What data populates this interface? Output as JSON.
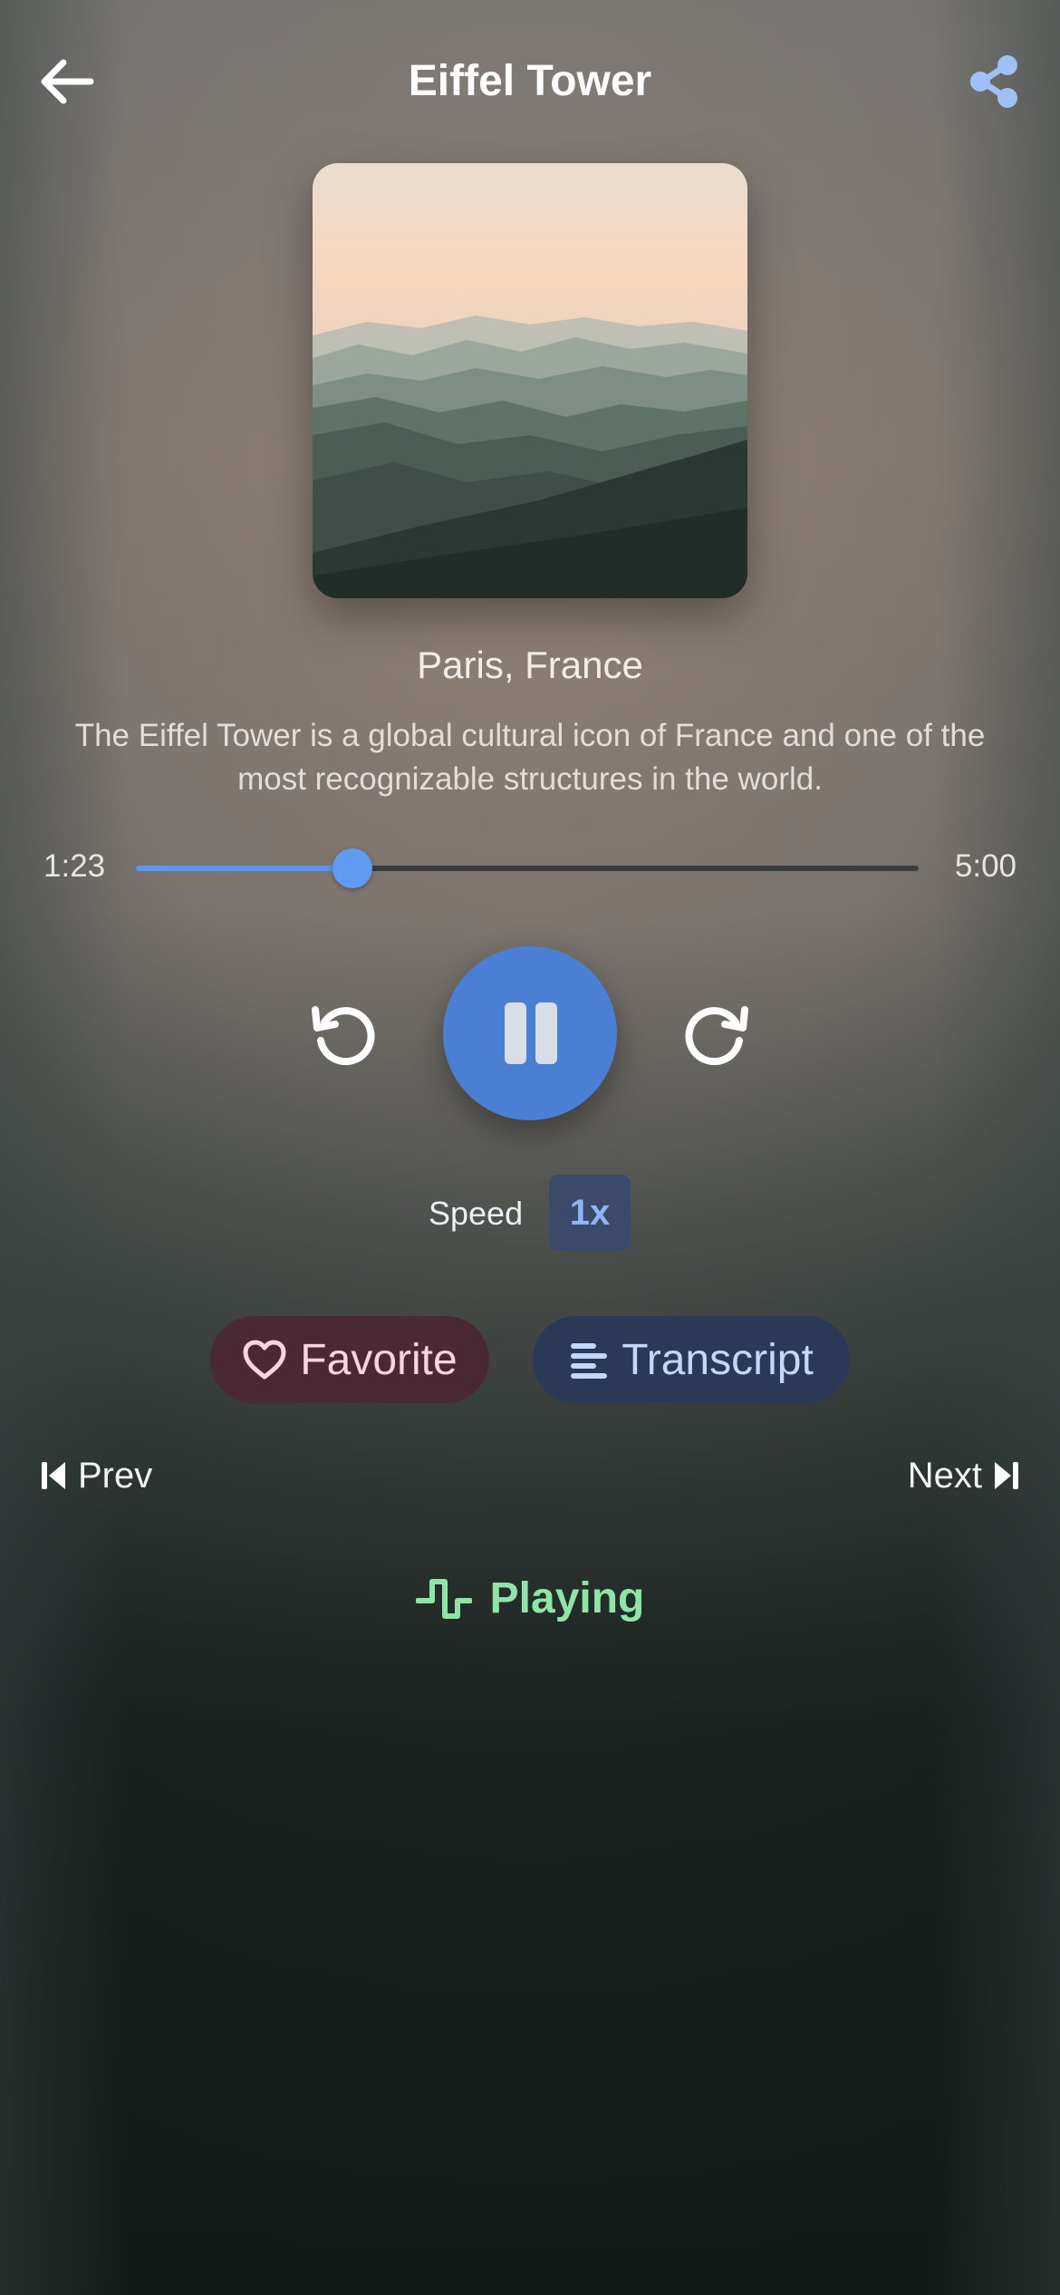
{
  "header": {
    "title": "Eiffel Tower",
    "back_icon": "arrow-left-icon",
    "share_icon": "share-icon"
  },
  "artwork": {
    "description": "misty mountain ridges at sunrise"
  },
  "track": {
    "location": "Paris, France",
    "description": "The Eiffel Tower is a global cultural icon of France and one of the most recognizable structures in the world."
  },
  "progress": {
    "current": "1:23",
    "total": "5:00",
    "fraction": 0.2767
  },
  "controls": {
    "rewind_icon": "rotate-ccw-icon",
    "play_state_icon": "pause-icon",
    "forward_icon": "rotate-cw-icon"
  },
  "speed": {
    "label": "Speed",
    "value": "1x"
  },
  "actions": {
    "favorite": "Favorite",
    "transcript": "Transcript"
  },
  "nav": {
    "prev": "Prev",
    "next": "Next"
  },
  "status": {
    "label": "Playing"
  },
  "colors": {
    "accent": "#4a7fd4",
    "slider": "#5d96ea",
    "playing": "#8ee5a6",
    "favorite_bg": "#4a2834",
    "transcript_bg": "#2a3958"
  }
}
